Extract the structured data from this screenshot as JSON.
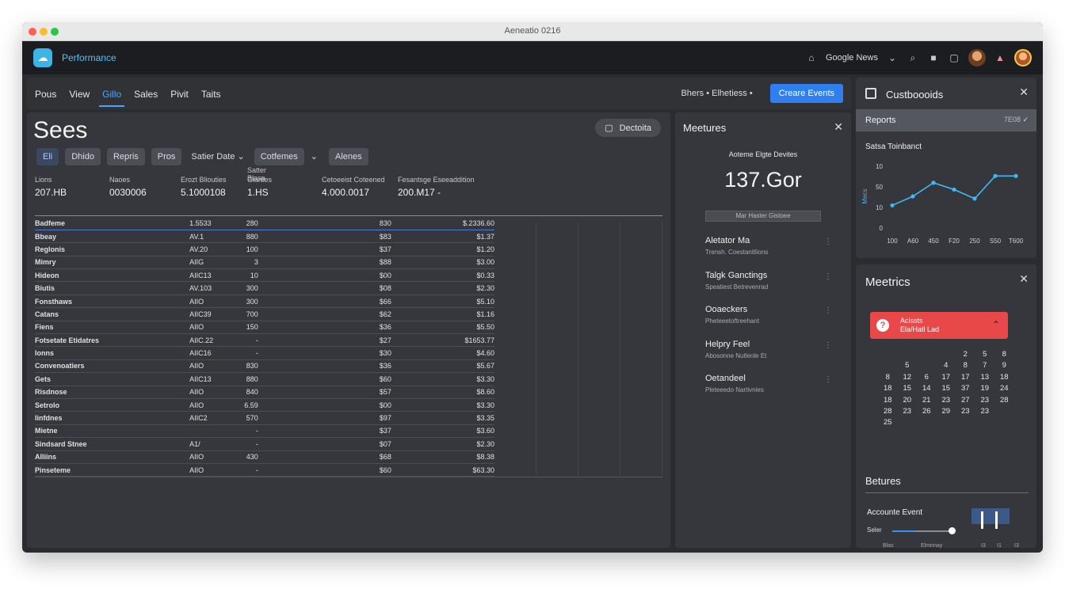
{
  "window": {
    "title": "Aeneatio 0216"
  },
  "app": {
    "name": "Performance",
    "account": "Google News"
  },
  "toolbar": {
    "tabs": [
      {
        "label": "Pous",
        "active": false
      },
      {
        "label": "View",
        "active": false
      },
      {
        "label": "Gillo",
        "active": true
      },
      {
        "label": "Sales",
        "active": false
      },
      {
        "label": "Pivit",
        "active": false
      },
      {
        "label": "Taits",
        "active": false
      }
    ],
    "dropdown": "Bhers • Elhetiess •",
    "create_button": "Creare Events"
  },
  "sales": {
    "title": "Sees",
    "details_button": "Dectoita",
    "filters": [
      "Eli",
      "Dhido",
      "Repris",
      "Pros"
    ],
    "date_filter": "Satier Date",
    "conformes_filter": "Cotfemes",
    "alares_chip": "Alenes",
    "stats": [
      {
        "label": "Lions",
        "value": "207.HB"
      },
      {
        "label": "Naoes",
        "value": "0030006"
      },
      {
        "label": "Erozt Bliouties",
        "value": "5.1000108"
      },
      {
        "label": "Giantes",
        "label_top": "Satter Blasp",
        "value": "1.HS"
      },
      {
        "label": "Cetoeeist Coteened",
        "value": "4.000.0017"
      },
      {
        "label": "Fesantsge Eseeaddition",
        "value": "200.M17 -"
      }
    ],
    "table": {
      "head": [
        "Badfeme",
        "",
        "1.5533",
        "280",
        "830",
        "$.2336.60"
      ],
      "rows": [
        [
          "Bbeay",
          "AV.1",
          "880",
          "$83",
          "$1.37"
        ],
        [
          "Reglonis",
          "AV.20",
          "100",
          "$37",
          "$1.20"
        ],
        [
          "Mimry",
          "AIIG",
          "3",
          "$88",
          "$3.00"
        ],
        [
          "Hideon",
          "AIIC13",
          "10",
          "$00",
          "$0.33"
        ],
        [
          "Biutis",
          "AV.103",
          "300",
          "$08",
          "$2.30"
        ],
        [
          "Fonsthaws",
          "AIIO",
          "300",
          "$66",
          "$5.10"
        ],
        [
          "Catans",
          "AIIC39",
          "700",
          "$62",
          "$1.16"
        ],
        [
          "Fiens",
          "AIIO",
          "150",
          "$36",
          "$5.50"
        ],
        [
          "Fotsetate Etidatres",
          "AIIC.22",
          "-",
          "$27",
          "$1653.77"
        ],
        [
          "Ionns",
          "AIIC16",
          "-",
          "$30",
          "$4.60"
        ],
        [
          "Convenoatiers",
          "AIIO",
          "830",
          "$36",
          "$5.67"
        ],
        [
          "Gets",
          "AIIC13",
          "880",
          "$60",
          "$3.30"
        ],
        [
          "Risdnose",
          "AIIO",
          "840",
          "$57",
          "$8.60"
        ],
        [
          "Setrolo",
          "AIIO",
          "6.59",
          "$00",
          "$3.30"
        ],
        [
          "Iinfdnes",
          "AIIC2",
          "570",
          "$97",
          "$3.35"
        ],
        [
          "Mietne",
          "",
          "-",
          "$37",
          "$3.60"
        ],
        [
          "Sindsard Stnee",
          "A1/",
          "-",
          "$07",
          "$2.30"
        ],
        [
          "Alliins",
          "AIIO",
          "430",
          "$68",
          "$8.38"
        ],
        [
          "Pinseteme",
          "AIIO",
          "-",
          "$60",
          "$63.30"
        ]
      ]
    }
  },
  "measures": {
    "title": "Meetures",
    "subtitle": "Aoteme Elgte Devites",
    "big_value": "137.Gor",
    "bar_label": "Mar Haster Gistoee",
    "items": [
      {
        "name": "Aletator Ma",
        "desc": "Trensh. Coestanitlions"
      },
      {
        "name": "Talgk Ganctings",
        "desc": "Speatiest Betrevenrad"
      },
      {
        "name": "Ooaeckers",
        "desc": "Pheteeetoftreehant"
      },
      {
        "name": "Helpry Feel",
        "desc": "Abosonne Nutlenle Et"
      },
      {
        "name": "Oetandeel",
        "desc": "Pleteeedo Nartivnies"
      }
    ]
  },
  "custom": {
    "title": "Custboooids",
    "reports_label": "Reports",
    "reports_value": "7E08",
    "chart_title": "Satsa Toinbanct"
  },
  "chart_data": {
    "type": "line",
    "title": "Satsa Toinbanct",
    "ylabel": "Mecs",
    "x_ticks": [
      "100",
      "A60",
      "450",
      "F20",
      "250",
      "S50",
      "T600"
    ],
    "y_ticks": [
      "0",
      "10",
      "50",
      "10"
    ],
    "values": [
      10,
      14,
      20,
      17,
      13,
      23,
      23
    ],
    "ylim": [
      0,
      28
    ],
    "color": "#3fb8f5"
  },
  "metrics": {
    "title": "Meetrics",
    "alert_line1": "Aclssts",
    "alert_line2": "Ela/Hatl Lad",
    "calendar": [
      [
        "",
        "",
        "",
        "",
        "2",
        "5",
        "8"
      ],
      [
        "",
        "5",
        "",
        "4",
        "8",
        "7",
        "9"
      ],
      [
        "8",
        "12",
        "6",
        "17",
        "17",
        "13",
        "18"
      ],
      [
        "18",
        "15",
        "14",
        "15",
        "37",
        "19",
        "24"
      ],
      [
        "18",
        "20",
        "21",
        "23",
        "27",
        "23",
        "28"
      ],
      [
        "28",
        "23",
        "26",
        "29",
        "23",
        "23",
        ""
      ],
      [
        "25",
        "",
        "",
        "",
        "",
        "",
        ""
      ]
    ],
    "section_title": "Betures",
    "account_event": "Accounte Event",
    "slider_label": "Seler",
    "mini_labels": [
      "Blas",
      "Elmnnay",
      "I3",
      "I1",
      "I3"
    ]
  }
}
